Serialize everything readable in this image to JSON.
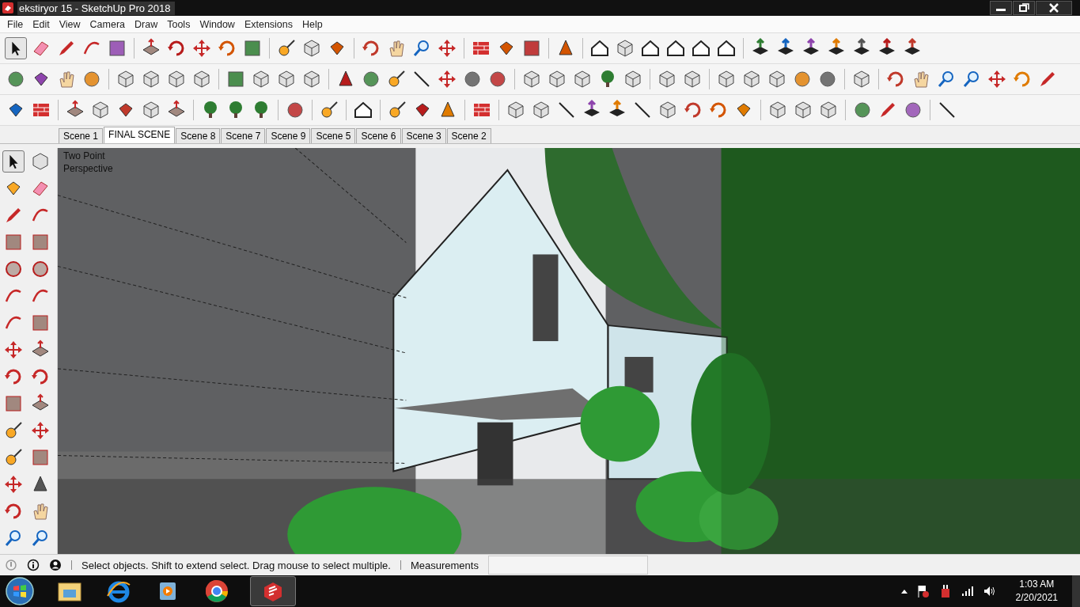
{
  "window": {
    "title": "ekstiryor 15 - SketchUp Pro 2018"
  },
  "menu": [
    "File",
    "Edit",
    "View",
    "Camera",
    "Draw",
    "Tools",
    "Window",
    "Extensions",
    "Help"
  ],
  "scene_tabs": [
    {
      "label": "Scene 1",
      "selected": false
    },
    {
      "label": "FINAL SCENE",
      "selected": true
    },
    {
      "label": "Scene 8",
      "selected": false
    },
    {
      "label": "Scene 7",
      "selected": false
    },
    {
      "label": "Scene 9",
      "selected": false
    },
    {
      "label": "Scene 5",
      "selected": false
    },
    {
      "label": "Scene 6",
      "selected": false
    },
    {
      "label": "Scene 3",
      "selected": false
    },
    {
      "label": "Scene 2",
      "selected": false
    }
  ],
  "viewport": {
    "camera_label": "Two Point Perspective"
  },
  "status_bar": {
    "message": "Select objects. Shift to extend select. Drag mouse to select multiple.",
    "measurements_label": "Measurements"
  },
  "taskbar": {
    "time": "1:03 AM",
    "date": "2/20/2021"
  }
}
